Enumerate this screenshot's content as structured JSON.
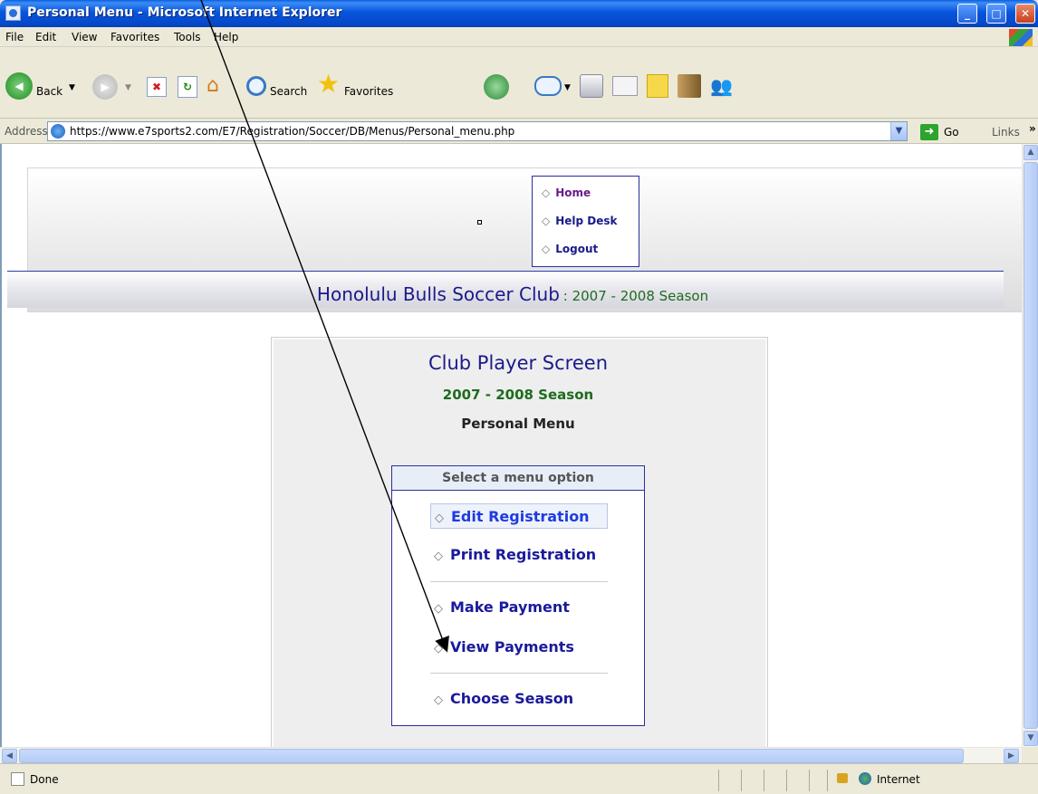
{
  "window": {
    "title": "Personal Menu - Microsoft Internet Explorer",
    "controls": [
      "minimize",
      "maximize",
      "close"
    ]
  },
  "menubar": {
    "items": [
      "File",
      "Edit",
      "View",
      "Favorites",
      "Tools",
      "Help"
    ]
  },
  "toolbar": {
    "back_label": "Back",
    "search_label": "Search",
    "favorites_label": "Favorites"
  },
  "address": {
    "label": "Address",
    "url": "https://www.e7sports2.com/E7/Registration/Soccer/DB/Menus/Personal_menu.php",
    "go_label": "Go",
    "links_label": "Links"
  },
  "header_nav": {
    "items": [
      "Home",
      "Help Desk",
      "Logout"
    ],
    "home_color": "#6b1a8a"
  },
  "club": {
    "name": "Honolulu Bulls Soccer Club",
    "season": ": 2007 - 2008 Season"
  },
  "panel": {
    "title": "Club Player Screen",
    "season": "2007 - 2008 Season",
    "subtitle": "Personal Menu"
  },
  "menu": {
    "header": "Select a menu option",
    "options": [
      "Edit Registration",
      "Print Registration",
      "Make Payment",
      "View Payments",
      "Choose Season"
    ],
    "active": "Edit Registration"
  },
  "statusbar": {
    "status": "Done",
    "zone": "Internet"
  },
  "colors": {
    "titlebar": "#0855dd",
    "link_navy": "#1a1a8a",
    "season_green": "#1e6b1e"
  }
}
